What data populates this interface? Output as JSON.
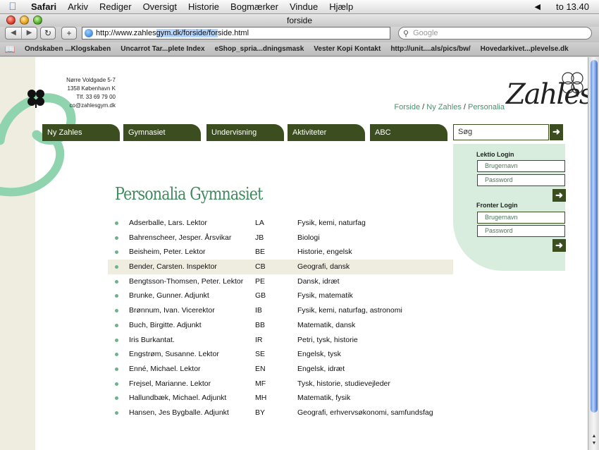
{
  "menubar": {
    "app": "Safari",
    "items": [
      "Arkiv",
      "Rediger",
      "Oversigt",
      "Historie",
      "Bogmærker",
      "Vindue",
      "Hjælp"
    ],
    "clock": "to 13.40"
  },
  "window": {
    "title": "forside"
  },
  "toolbar": {
    "url": "http://www.zahlesgym.dk/forside/forside.html",
    "url_a": "http://www.zahles",
    "url_sel": "gym.dk/forside/for",
    "url_b": "side.html",
    "search_placeholder": "Google"
  },
  "bookmarks": [
    "Ondskaben ...Klogskaben",
    "Uncarrot Tar...plete Index",
    "eShop_spria...dningsmask",
    "Vester Kopi Kontakt",
    "http://unit....als/pics/bw/",
    "Hovedarkivet...plevelse.dk"
  ],
  "site": {
    "address": [
      "Nørre Voldgade 5-7",
      "1358 København K",
      "Tlf. 33 69 79 00",
      "co@zahlesgym.dk"
    ],
    "logo_text": "Zahles",
    "breadcrumb": [
      "Forside",
      "Ny Zahles",
      "Personalia"
    ],
    "nav": [
      "Ny Zahles",
      "Gymnasiet",
      "Undervisning",
      "Aktiviteter",
      "ABC"
    ],
    "search_label": "Søg",
    "lektio": {
      "title": "Lektio Login",
      "user": "Brugernavn",
      "pass": "Password"
    },
    "fronter": {
      "title": "Fronter Login",
      "user": "Brugernavn",
      "pass": "Password"
    },
    "accent": "#3c4d1f",
    "green": "#3f8a5e"
  },
  "heading": "Personalia Gymnasiet",
  "staff": [
    {
      "name": "Adserballe, Lars. Lektor",
      "code": "LA",
      "subjects": "Fysik, kemi, naturfag"
    },
    {
      "name": "Bahrenscheer, Jesper. Årsvikar",
      "code": "JB",
      "subjects": "Biologi"
    },
    {
      "name": "Beisheim, Peter. Lektor",
      "code": "BE",
      "subjects": "Historie, engelsk"
    },
    {
      "name": "Bender, Carsten. Inspektor",
      "code": "CB",
      "subjects": "Geografi, dansk"
    },
    {
      "name": "Bengtsson-Thomsen, Peter. Lektor",
      "code": "PE",
      "subjects": "Dansk, idræt"
    },
    {
      "name": "Brunke, Gunner. Adjunkt",
      "code": "GB",
      "subjects": "Fysik, matematik"
    },
    {
      "name": "Brønnum, Ivan. Vicerektor",
      "code": "IB",
      "subjects": "Fysik, kemi, naturfag, astronomi"
    },
    {
      "name": "Buch, Birgitte. Adjunkt",
      "code": "BB",
      "subjects": " Matematik, dansk"
    },
    {
      "name": "Iris Burkantat.",
      "code": "IR",
      "subjects": "Petri, tysk, historie"
    },
    {
      "name": "Engstrøm, Susanne. Lektor",
      "code": "SE",
      "subjects": "Engelsk, tysk"
    },
    {
      "name": "Enné, Michael. Lektor",
      "code": "EN",
      "subjects": "Engelsk, idræt"
    },
    {
      "name": "Frejsel, Marianne. Lektor",
      "code": "MF",
      "subjects": "Tysk, historie, studievejleder"
    },
    {
      "name": "Hallundbæk, Michael. Adjunkt",
      "code": "MH",
      "subjects": "Matematik, fysik"
    },
    {
      "name": "Hansen, Jes Bygballe. Adjunkt",
      "code": "BY",
      "subjects": "Geografi, erhvervsøkonomi, samfundsfag"
    }
  ],
  "highlighted_row": 3
}
